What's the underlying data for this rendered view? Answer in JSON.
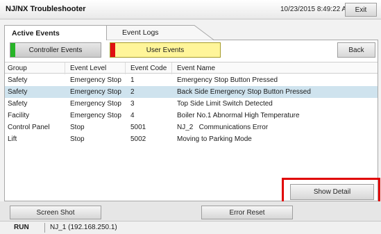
{
  "app": {
    "title": "NJ/NX Troubleshooter",
    "datetime": "10/23/2015 8:49:22 AM",
    "exit_label": "Exit"
  },
  "tabs": [
    {
      "label": "Active Events",
      "active": true
    },
    {
      "label": "Event Logs",
      "active": false
    }
  ],
  "filters": {
    "controller_events": {
      "label": "Controller Events",
      "indicator_color": "#27b427"
    },
    "user_events": {
      "label": "User Events",
      "indicator_color": "#e01010"
    }
  },
  "back_label": "Back",
  "table": {
    "columns": [
      "Group",
      "Event Level",
      "Event Code",
      "Event Name"
    ],
    "rows": [
      {
        "group": "Safety",
        "level": "Emergency Stop",
        "code": "1",
        "name": "Emergency Stop Button Pressed",
        "selected": false
      },
      {
        "group": "Safety",
        "level": "Emergency Stop",
        "code": "2",
        "name": "Back Side Emergency Stop Button Pressed",
        "selected": true
      },
      {
        "group": "Safety",
        "level": "Emergency Stop",
        "code": "3",
        "name": "Top Side Limit Switch Detected",
        "selected": false
      },
      {
        "group": "Facility",
        "level": "Emergency Stop",
        "code": "4",
        "name": "Boiler No.1 Abnormal High Temperature",
        "selected": false
      },
      {
        "group": "Control Panel",
        "level": "Stop",
        "code": "5001",
        "name": "NJ_2   Communications Error",
        "selected": false
      },
      {
        "group": "Lift",
        "level": "Stop",
        "code": "5002",
        "name": "Moving to Parking Mode",
        "selected": false
      }
    ]
  },
  "show_detail_label": "Show Detail",
  "highlight_color": "#e00000",
  "bottom": {
    "screenshot_label": "Screen Shot",
    "error_reset_label": "Error Reset"
  },
  "status": {
    "mode": "RUN",
    "node": "NJ_1 (192.168.250.1)"
  }
}
